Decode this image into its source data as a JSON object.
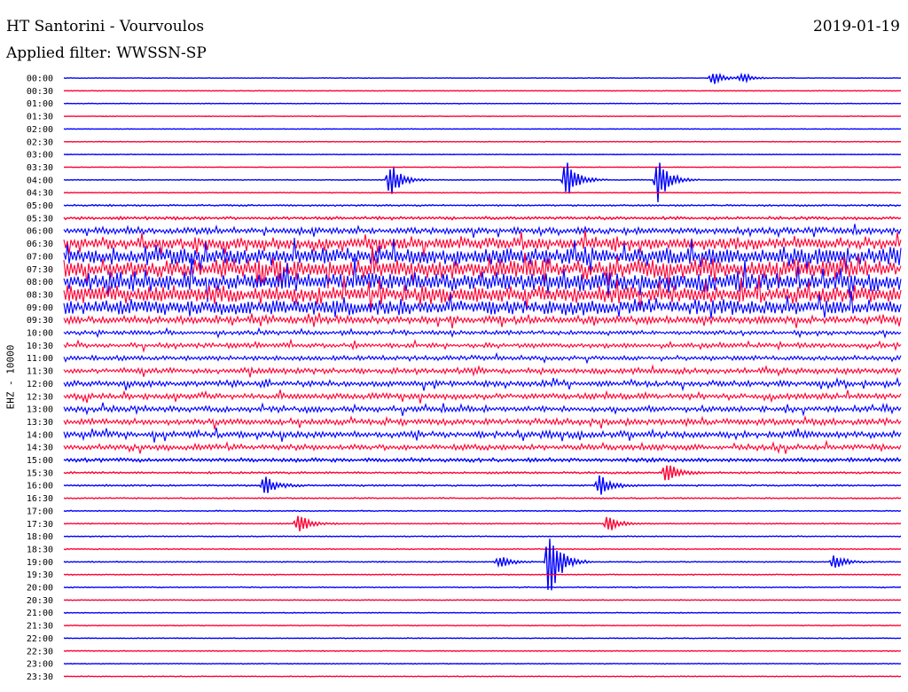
{
  "header": {
    "station": "HT Santorini - Vourvoulos",
    "date": "2019-01-19",
    "filter": "Applied filter: WWSSN-SP"
  },
  "chart_data": {
    "type": "line",
    "ylabel": "EHZ - 10000",
    "colors": [
      "#0000ff",
      "#ff0033"
    ],
    "rows": [
      "00:00",
      "00:30",
      "01:00",
      "01:30",
      "02:00",
      "02:30",
      "03:00",
      "03:30",
      "04:00",
      "04:30",
      "05:00",
      "05:30",
      "06:00",
      "06:30",
      "07:00",
      "07:30",
      "08:00",
      "08:30",
      "09:00",
      "09:30",
      "10:00",
      "10:30",
      "11:00",
      "11:30",
      "12:00",
      "12:30",
      "13:00",
      "13:30",
      "14:00",
      "14:30",
      "15:00",
      "15:30",
      "16:00",
      "16:30",
      "17:00",
      "17:30",
      "18:00",
      "18:30",
      "19:00",
      "19:30",
      "20:00",
      "20:30",
      "21:00",
      "21:30",
      "22:00",
      "22:30",
      "23:00",
      "23:30"
    ],
    "noise_level": [
      0.3,
      0.3,
      0.3,
      0.3,
      0.3,
      0.3,
      0.3,
      0.3,
      0.4,
      0.4,
      0.8,
      1.5,
      3.5,
      6,
      9,
      10,
      10,
      9,
      8,
      4,
      2.2,
      2.5,
      2.5,
      3,
      3,
      3,
      3,
      3.2,
      3.5,
      3,
      2,
      1,
      0.8,
      0.6,
      0.5,
      0.5,
      0.5,
      0.5,
      0.5,
      0.5,
      0.5,
      0.4,
      0.4,
      0.4,
      0.4,
      0.4,
      0.4,
      0.4
    ],
    "events": [
      {
        "row": "00:00",
        "x": 0.775,
        "amp": 8
      },
      {
        "row": "00:00",
        "x": 0.81,
        "amp": 6
      },
      {
        "row": "04:00",
        "x": 0.39,
        "amp": 20
      },
      {
        "row": "04:00",
        "x": 0.6,
        "amp": 24
      },
      {
        "row": "04:00",
        "x": 0.71,
        "amp": 26
      },
      {
        "row": "16:00",
        "x": 0.24,
        "amp": 12
      },
      {
        "row": "16:00",
        "x": 0.64,
        "amp": 12
      },
      {
        "row": "17:30",
        "x": 0.28,
        "amp": 12
      },
      {
        "row": "17:30",
        "x": 0.65,
        "amp": 10
      },
      {
        "row": "19:00",
        "x": 0.52,
        "amp": 8
      },
      {
        "row": "19:00",
        "x": 0.58,
        "amp": 45
      },
      {
        "row": "19:00",
        "x": 0.92,
        "amp": 8
      },
      {
        "row": "15:30",
        "x": 0.72,
        "amp": 14
      }
    ]
  }
}
